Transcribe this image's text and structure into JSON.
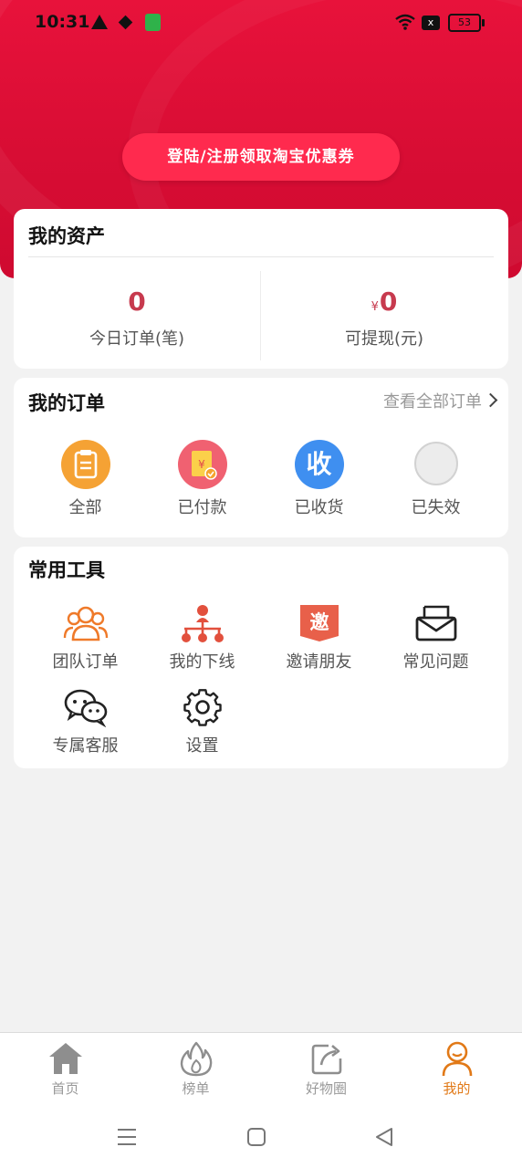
{
  "status_bar": {
    "time": "10:31",
    "battery": "53",
    "sim_label": "x"
  },
  "header": {
    "login_button": "登陆/注册领取淘宝优惠券"
  },
  "assets": {
    "title": "我的资产",
    "today_orders": {
      "value": "0",
      "label": "今日订单(笔)"
    },
    "withdrawable": {
      "currency": "¥",
      "value": "0",
      "label": "可提现(元)"
    }
  },
  "orders": {
    "title": "我的订单",
    "view_all": "查看全部订单",
    "items": [
      {
        "label": "全部",
        "icon": "clipboard-icon"
      },
      {
        "label": "已付款",
        "icon": "paid-icon"
      },
      {
        "label": "已收货",
        "icon": "received-icon",
        "glyph": "收"
      },
      {
        "label": "已失效",
        "icon": "invalid-icon"
      }
    ]
  },
  "tools": {
    "title": "常用工具",
    "items": [
      {
        "label": "团队订单",
        "icon": "team-icon"
      },
      {
        "label": "我的下线",
        "icon": "hierarchy-icon"
      },
      {
        "label": "邀请朋友",
        "icon": "invite-icon",
        "glyph": "邀"
      },
      {
        "label": "常见问题",
        "icon": "mail-icon"
      },
      {
        "label": "专属客服",
        "icon": "wechat-icon"
      },
      {
        "label": "设置",
        "icon": "gear-icon"
      }
    ]
  },
  "bottom_nav": {
    "items": [
      {
        "label": "首页",
        "icon": "home-icon"
      },
      {
        "label": "榜单",
        "icon": "flame-icon"
      },
      {
        "label": "好物圈",
        "icon": "share-icon"
      },
      {
        "label": "我的",
        "icon": "user-icon",
        "active": true
      }
    ]
  },
  "colors": {
    "header_red": "#d80d34",
    "login_button": "#ff2a4e",
    "accent_value": "#c73a4e",
    "nav_active": "#e17917",
    "tool_orange": "#ef7a2a",
    "tool_red": "#e2503d"
  }
}
